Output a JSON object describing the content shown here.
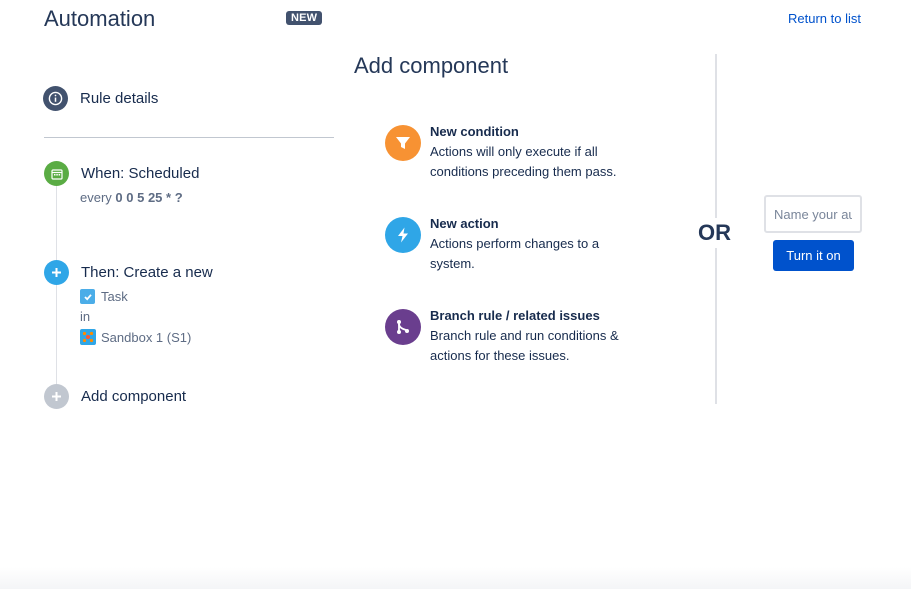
{
  "header": {
    "title": "Automation",
    "badge": "NEW",
    "return_link": "Return to list"
  },
  "rail": {
    "details_label": "Rule details",
    "trigger": {
      "label": "When: Scheduled",
      "prefix": "every",
      "cron": "0 0 5 25 * ?"
    },
    "action": {
      "label": "Then: Create a new",
      "issue_type": "Task",
      "connector": "in",
      "project": "Sandbox 1 (S1)"
    },
    "add_label": "Add component"
  },
  "main": {
    "heading": "Add component",
    "components": [
      {
        "title": "New condition",
        "desc": "Actions will only execute if all conditions preceding them pass.",
        "icon": "filter-icon",
        "color": "#f79233"
      },
      {
        "title": "New action",
        "desc": "Actions perform changes to a system.",
        "icon": "lightning-icon",
        "color": "#2fa6e7"
      },
      {
        "title": "Branch rule / related issues",
        "desc": "Branch rule and run conditions & actions for these issues.",
        "icon": "branch-icon",
        "color": "#6a3e8e"
      }
    ]
  },
  "side": {
    "or_label": "OR",
    "name_placeholder": "Name your automation",
    "turn_on_label": "Turn it on"
  },
  "colors": {
    "primary": "#0052cc",
    "trigger_green": "#5aac44",
    "action_blue": "#2fa6e7",
    "text_dark": "#172b4d"
  }
}
